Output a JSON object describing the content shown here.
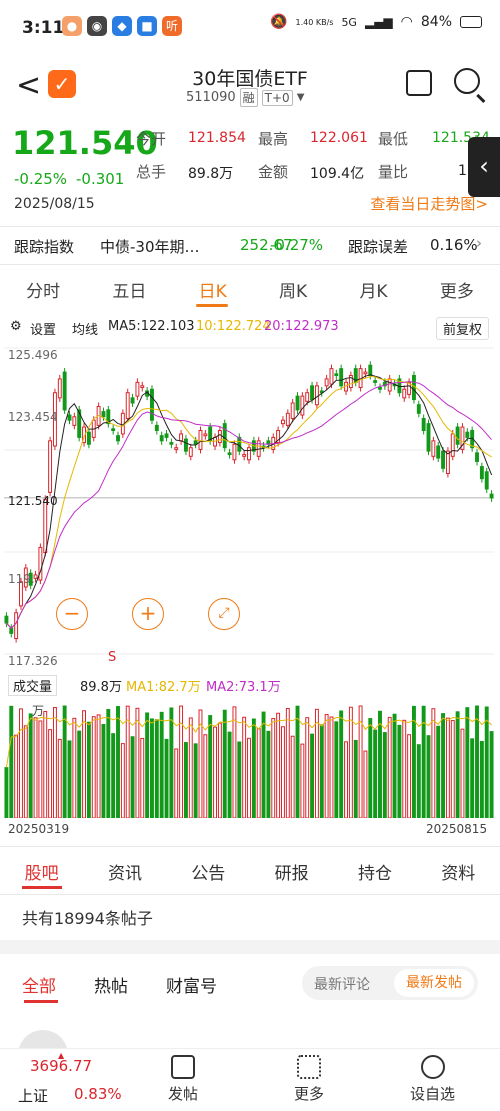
{
  "status": {
    "time": "3:11",
    "speed": "1.40 KB/s",
    "battery": "84%",
    "net": "5G"
  },
  "header": {
    "title": "30年国债ETF",
    "code": "511090",
    "tag1": "融",
    "tag2": "T+0"
  },
  "quote": {
    "price": "121.540",
    "change_pct": "-0.25%",
    "change": "-0.301",
    "date": "2025/08/15",
    "open_label": "今开",
    "open": "121.854",
    "high_label": "最高",
    "high": "122.061",
    "low_label": "最低",
    "low": "121.534",
    "hand_label": "总手",
    "hand": "89.8万",
    "amount_label": "金额",
    "amount": "109.4亿",
    "ratio_label": "量比",
    "ratio": "1",
    "trend_link": "查看当日走势图>"
  },
  "track": {
    "label": "跟踪指数",
    "index": "中债-30年期…",
    "value": "252.67",
    "pct": "-0.27%",
    "err_label": "跟踪误差",
    "err": "0.16%"
  },
  "tabs": [
    "分时",
    "五日",
    "日K",
    "周K",
    "月K",
    "更多"
  ],
  "chart": {
    "settings": "设置",
    "ma_label": "均线",
    "ma5": "MA5:122.103",
    "ma10": "10:122.724",
    "ma20": "20:122.973",
    "adjust": "前复权",
    "y_high": "125.496",
    "y_mid": "123.454",
    "y_cur": "121.540",
    "y_low": "117.326",
    "y_small": "119.",
    "marker": "S",
    "vol_label": "成交量",
    "vol": "89.8万",
    "vma1": "MA1:82.7万",
    "vma2": "MA2:73.1万",
    "vol_unit": "万",
    "date_start": "20250319",
    "date_end": "20250815",
    "colors": {
      "ma5": "#222222",
      "ma10": "#e6b800",
      "ma20": "#c02ec8",
      "up": "#d9262c",
      "down": "#12991a"
    }
  },
  "chart_data": {
    "type": "candlestick",
    "x_start": "20250319",
    "x_end": "20250815",
    "close": [
      117.9,
      117.6,
      118.2,
      119.1,
      119.5,
      119.0,
      119.3,
      120.1,
      121.5,
      123.2,
      124.6,
      125.0,
      124.1,
      123.8,
      123.9,
      123.3,
      123.6,
      123.1,
      123.8,
      124.2,
      123.9,
      123.7,
      123.5,
      123.2,
      124.0,
      124.6,
      124.3,
      124.9,
      124.8,
      124.5,
      123.8,
      123.5,
      123.2,
      123.3,
      123.1,
      123.0,
      123.4,
      122.9,
      123.0,
      123.1,
      123.5,
      123.4,
      123.2,
      123.3,
      123.5,
      123.0,
      122.8,
      123.1,
      122.9,
      122.8,
      123.0,
      122.9,
      123.2,
      123.0,
      123.1,
      123.3,
      123.5,
      123.8,
      124.0,
      124.3,
      124.1,
      124.5,
      124.6,
      124.4,
      124.8,
      124.6,
      125.0,
      125.3,
      125.1,
      124.8,
      124.9,
      125.1,
      124.9,
      125.3,
      125.2,
      125.1,
      124.9,
      124.7,
      124.8,
      125.0,
      124.8,
      124.6,
      124.7,
      124.9,
      124.4,
      124.0,
      123.5,
      122.9,
      123.2,
      122.7,
      122.4,
      122.9,
      123.4,
      123.1,
      123.6,
      123.3,
      123.0,
      122.6,
      122.1,
      121.8,
      121.54
    ]
  },
  "subtabs": [
    "股吧",
    "资讯",
    "公告",
    "研报",
    "持仓",
    "资料"
  ],
  "posts": "共有18994条帖子",
  "feedtabs": [
    "全部",
    "热帖",
    "财富号"
  ],
  "pill": {
    "a": "最新评论",
    "b": "最新发帖"
  },
  "bottom": {
    "index_val": "3696.77",
    "index_name": "上证",
    "index_pct": "0.83%",
    "post": "发帖",
    "more": "更多",
    "custom": "设自选"
  }
}
